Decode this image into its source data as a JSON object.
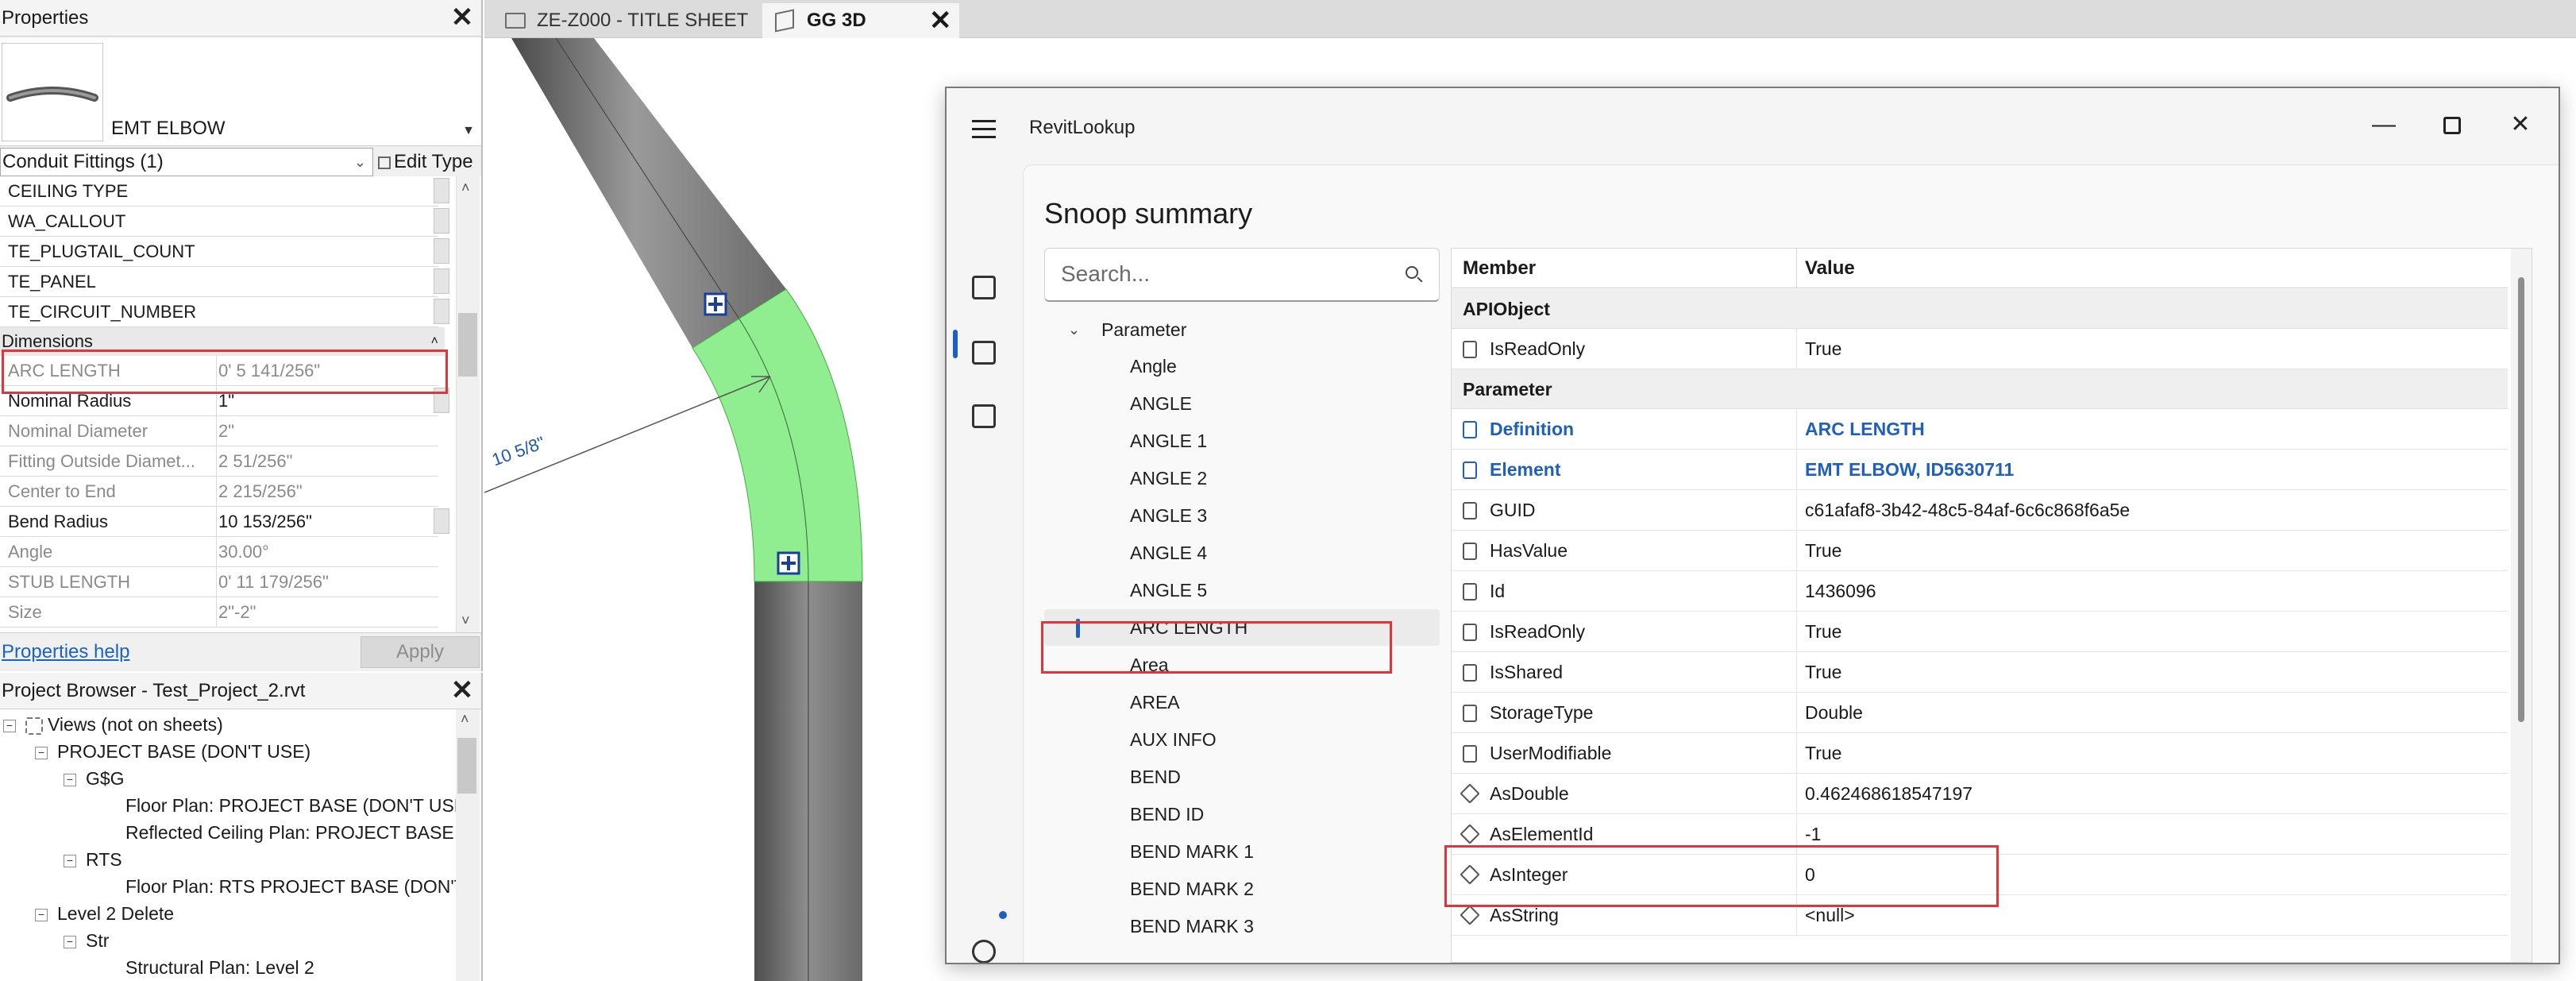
{
  "properties": {
    "title": "Properties",
    "type_name": "EMT ELBOW",
    "filter": "Conduit Fittings (1)",
    "edit_type": "Edit Type",
    "rows_top": [
      {
        "name": "CEILING TYPE",
        "value": ""
      },
      {
        "name": "WA_CALLOUT",
        "value": ""
      },
      {
        "name": "TE_PLUGTAIL_COUNT",
        "value": ""
      },
      {
        "name": "TE_PANEL",
        "value": ""
      },
      {
        "name": "TE_CIRCUIT_NUMBER",
        "value": ""
      }
    ],
    "group_dimensions": "Dimensions",
    "rows_dim": [
      {
        "name": "ARC LENGTH",
        "value": "0'  5 141/256\""
      },
      {
        "name": "Nominal Radius",
        "value": "1\""
      },
      {
        "name": "Nominal Diameter",
        "value": "2\""
      },
      {
        "name": "Fitting Outside Diamet...",
        "value": "2 51/256\""
      },
      {
        "name": "Center to End",
        "value": "2 215/256\""
      },
      {
        "name": "Bend Radius",
        "value": "10 153/256\""
      },
      {
        "name": "Angle",
        "value": "30.00°"
      },
      {
        "name": "STUB LENGTH",
        "value": "0'  11 179/256\""
      },
      {
        "name": "Size",
        "value": "2\"-2\""
      }
    ],
    "help_link": "Properties help",
    "apply": "Apply"
  },
  "browser": {
    "title": "Project Browser - Test_Project_2.rvt",
    "items": [
      {
        "label": "Views (not on sheets)",
        "box": "−"
      },
      {
        "label": "PROJECT BASE (DON'T USE)",
        "box": "−"
      },
      {
        "label": "G$G",
        "box": "−"
      },
      {
        "label": "Floor Plan: PROJECT BASE (DON'T USE"
      },
      {
        "label": "Reflected Ceiling Plan: PROJECT BASE ("
      },
      {
        "label": "RTS",
        "box": "−"
      },
      {
        "label": "Floor Plan: RTS PROJECT BASE (DON'T"
      },
      {
        "label": "Level 2 Delete",
        "box": "−"
      },
      {
        "label": "Str",
        "box": "−"
      },
      {
        "label": "Structural Plan: Level 2"
      }
    ]
  },
  "tabs": {
    "title_sheet": "ZE-Z000 - TITLE SHEET",
    "view_3d": "GG 3D"
  },
  "canvas": {
    "dimension_label": "10 5/8\"",
    "highlight_color": "#90ee90"
  },
  "revitlookup": {
    "window_title": "RevitLookup",
    "heading": "Snoop summary",
    "search_placeholder": "Search...",
    "tree_root": "Parameter",
    "tree_items": [
      "Angle",
      "ANGLE",
      "ANGLE 1",
      "ANGLE 2",
      "ANGLE 3",
      "ANGLE 4",
      "ANGLE 5",
      "ARC LENGTH",
      "Area",
      "AREA",
      "AUX INFO",
      "BEND",
      "BEND ID",
      "BEND MARK 1",
      "BEND MARK 2",
      "BEND MARK 3"
    ],
    "selected_item": "ARC LENGTH",
    "col_member": "Member",
    "col_value": "Value",
    "group_apiobject": "APIObject",
    "group_parameter": "Parameter",
    "rows_api": [
      {
        "member": "IsReadOnly",
        "value": "True"
      }
    ],
    "rows_param": [
      {
        "member": "Definition",
        "value": "ARC LENGTH",
        "link": true
      },
      {
        "member": "Element",
        "value": "EMT ELBOW, ID5630711",
        "link": true
      },
      {
        "member": "GUID",
        "value": "c61afaf8-3b42-48c5-84af-6c6c868f6a5e"
      },
      {
        "member": "HasValue",
        "value": "True"
      },
      {
        "member": "Id",
        "value": "1436096"
      },
      {
        "member": "IsReadOnly",
        "value": "True"
      },
      {
        "member": "IsShared",
        "value": "True"
      },
      {
        "member": "StorageType",
        "value": "Double"
      },
      {
        "member": "UserModifiable",
        "value": "True"
      },
      {
        "member": "AsDouble",
        "value": "0.462468618547197",
        "method": true
      },
      {
        "member": "AsElementId",
        "value": "-1",
        "method": true
      },
      {
        "member": "AsInteger",
        "value": "0",
        "method": true
      },
      {
        "member": "AsString",
        "value": "<null>",
        "method": true
      }
    ],
    "accent_color": "#1f5fbf",
    "highlight_color": "#e0353b"
  }
}
